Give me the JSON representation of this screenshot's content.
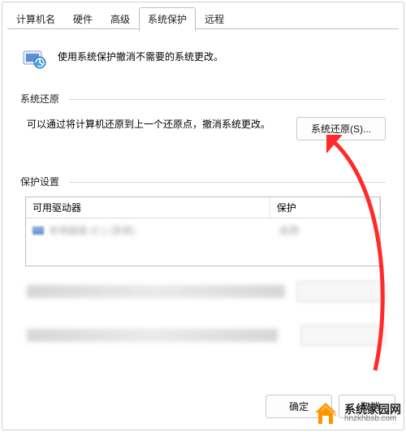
{
  "tabs": {
    "items": [
      {
        "label": "计算机名"
      },
      {
        "label": "硬件"
      },
      {
        "label": "高级"
      },
      {
        "label": "系统保护"
      },
      {
        "label": "远程"
      }
    ],
    "active_index": 3
  },
  "intro": {
    "text": "使用系统保护撤消不需要的系统更改。"
  },
  "restore_section": {
    "title": "系统还原",
    "desc": "可以通过将计算机还原到上一个还原点，撤消系统更改。",
    "button_label": "系统还原(S)..."
  },
  "settings_section": {
    "title": "保护设置",
    "col_drive": "可用驱动器",
    "col_protect": "保护",
    "drive_row_text": "本地磁盘 (C:) (系统)",
    "protect_row_text": "启用"
  },
  "bottom_buttons": {
    "ok": "确定",
    "cancel": "取消"
  },
  "watermark": {
    "title": "系统家园网",
    "sub": "hnzkhbsb.com"
  },
  "colors": {
    "arrow": "#ff2a2a",
    "accent": "#ff9400"
  }
}
